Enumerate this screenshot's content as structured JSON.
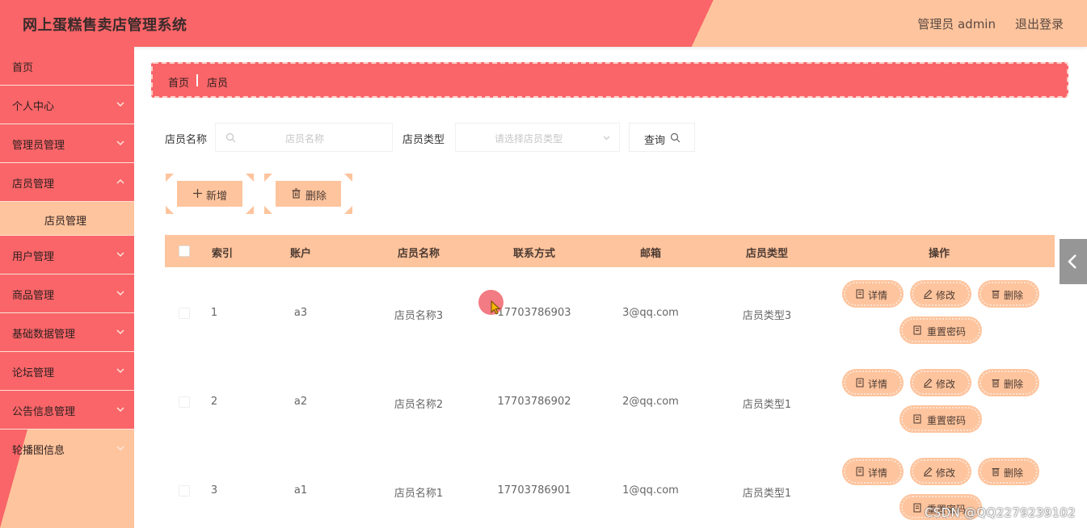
{
  "header": {
    "title": "网上蛋糕售卖店管理系统",
    "admin_text": "管理员 admin",
    "logout": "退出登录"
  },
  "colors": {
    "primary": "#f96568",
    "secondary": "#fec49d"
  },
  "sidebar": {
    "items": [
      {
        "label": "首页",
        "icon": "none"
      },
      {
        "label": "个人中心",
        "icon": "chevron-down-icon"
      },
      {
        "label": "管理员管理",
        "icon": "chevron-down-icon"
      },
      {
        "label": "店员管理",
        "icon": "chevron-up-icon"
      },
      {
        "label": "店员管理",
        "icon": "none"
      },
      {
        "label": "用户管理",
        "icon": "chevron-down-icon"
      },
      {
        "label": "商品管理",
        "icon": "chevron-down-icon"
      },
      {
        "label": "基础数据管理",
        "icon": "chevron-down-icon"
      },
      {
        "label": "论坛管理",
        "icon": "chevron-down-icon"
      },
      {
        "label": "公告信息管理",
        "icon": "chevron-down-icon"
      },
      {
        "label": "轮播图信息",
        "icon": "chevron-down-icon"
      }
    ]
  },
  "breadcrumb": {
    "home": "首页",
    "current": "店员"
  },
  "search": {
    "name_label": "店员名称",
    "name_placeholder": "店员名称",
    "type_label": "店员类型",
    "type_placeholder": "请选择店员类型",
    "query_button": "查询"
  },
  "actions": {
    "add": "新增",
    "delete": "删除"
  },
  "table": {
    "headers": [
      "索引",
      "账户",
      "店员名称",
      "联系方式",
      "邮箱",
      "店员类型",
      "操作"
    ],
    "rows": [
      {
        "index": "1",
        "account": "a3",
        "name": "店员名称3",
        "phone": "17703786903",
        "email": "3@qq.com",
        "type": "店员类型3"
      },
      {
        "index": "2",
        "account": "a2",
        "name": "店员名称2",
        "phone": "17703786902",
        "email": "2@qq.com",
        "type": "店员类型1"
      },
      {
        "index": "3",
        "account": "a1",
        "name": "店员名称1",
        "phone": "17703786901",
        "email": "1@qq.com",
        "type": "店员类型1"
      }
    ],
    "ops": {
      "detail": "详情",
      "edit": "修改",
      "delete": "删除",
      "reset": "重置密码"
    }
  },
  "watermark": "CSDN @QQ2279239102"
}
